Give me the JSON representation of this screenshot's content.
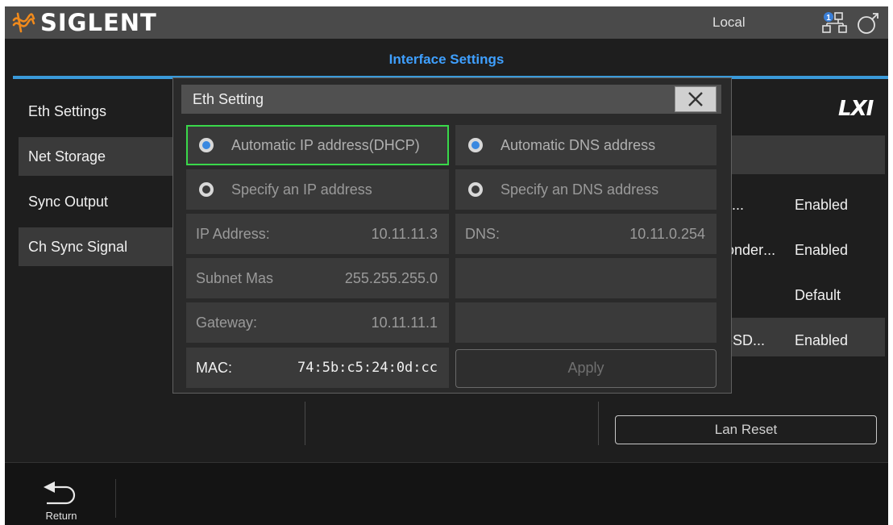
{
  "topbar": {
    "brand": "SIGLENT",
    "status": "Local",
    "network_badge": "1"
  },
  "page_title": "Interface Settings",
  "menu": [
    {
      "label": "Eth Settings"
    },
    {
      "label": "Net Storage"
    },
    {
      "label": "Sync Output"
    },
    {
      "label": "Ch Sync Signal"
    }
  ],
  "background_panel": {
    "logo": "LXI",
    "rows": [
      {
        "label": "...IP:",
        "value": "Enabled"
      },
      {
        "label": "...ponder:",
        "value": "Enabled"
      },
      {
        "label": "...:",
        "value": "Default"
      },
      {
        "label": "...S-SD:",
        "value": "Enabled"
      }
    ],
    "lan_reset_label": "Lan Reset"
  },
  "dialog": {
    "title": "Eth Setting",
    "ip_auto_label": "Automatic IP address(DHCP)",
    "ip_manual_label": "Specify an IP address",
    "dns_auto_label": "Automatic DNS address",
    "dns_manual_label": "Specify an DNS address",
    "ip_address_label": "IP Address:",
    "ip_address_value": "10.11.11.3",
    "subnet_label": "Subnet Mas",
    "subnet_value": "255.255.255.0",
    "gateway_label": "Gateway:",
    "gateway_value": "10.11.11.1",
    "mac_label": "MAC:",
    "mac_value": "74:5b:c5:24:0d:cc",
    "dns_label": "DNS:",
    "dns_value": "10.11.0.254",
    "apply_label": "Apply"
  },
  "bottombar": {
    "return_label": "Return"
  },
  "colors": {
    "accent": "#3fa0ff",
    "focus": "#39d84a",
    "radio_selected": "#3a88e0",
    "logo_orange": "#f08a1c"
  }
}
